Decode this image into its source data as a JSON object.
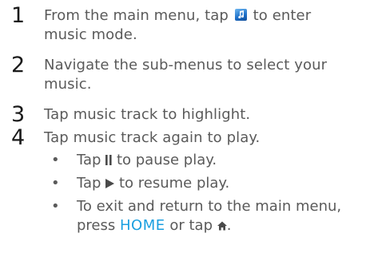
{
  "steps": [
    {
      "number": "1",
      "before": "From the main menu, tap",
      "after": "to enter",
      "line2": "music mode.",
      "icon": "music-app-icon"
    },
    {
      "number": "2",
      "line1": "Navigate the sub-menus to select your",
      "line2": "music."
    },
    {
      "number": "3",
      "text": "Tap music track to highlight."
    },
    {
      "number": "4",
      "text": "Tap music track again to play."
    }
  ],
  "bullets": [
    {
      "before": "Tap",
      "after": "to pause play.",
      "icon": "pause-icon"
    },
    {
      "before": "Tap",
      "after": "to resume play.",
      "icon": "play-icon"
    },
    {
      "line1": "To exit and return to the main menu,",
      "press": "press",
      "key": "HOME",
      "or_tap": "or tap",
      "end": ".",
      "icon": "home-icon"
    }
  ],
  "bullet_symbol": "•",
  "colors": {
    "text": "#5a5a5a",
    "number": "#1a1a1a",
    "home_key": "#1a9fe0",
    "music_icon": "#1d6fc8"
  }
}
